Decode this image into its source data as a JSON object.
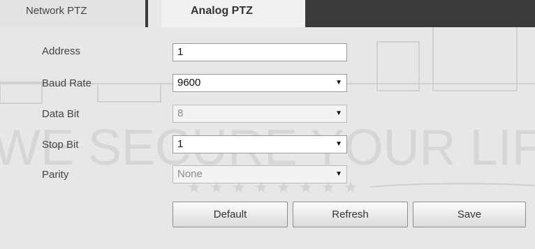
{
  "tabs": [
    {
      "label": "Network PTZ",
      "active": false
    },
    {
      "label": "Analog PTZ",
      "active": true
    }
  ],
  "form": {
    "address": {
      "label": "Address",
      "value": "1"
    },
    "baud_rate": {
      "label": "Baud Rate",
      "value": "9600"
    },
    "data_bit": {
      "label": "Data Bit",
      "value": "8",
      "disabled": true
    },
    "stop_bit": {
      "label": "Stop Bit",
      "value": "1"
    },
    "parity": {
      "label": "Parity",
      "value": "None",
      "disabled": true
    }
  },
  "buttons": {
    "default_label": "Default",
    "refresh_label": "Refresh",
    "save_label": "Save"
  },
  "watermark": {
    "text": "WE SECURE YOUR LIFE"
  },
  "colors": {
    "tab_dark": "#3a3a3a",
    "background": "#e7e7e7"
  },
  "icons": {
    "dropdown": "chevron-down-icon"
  }
}
